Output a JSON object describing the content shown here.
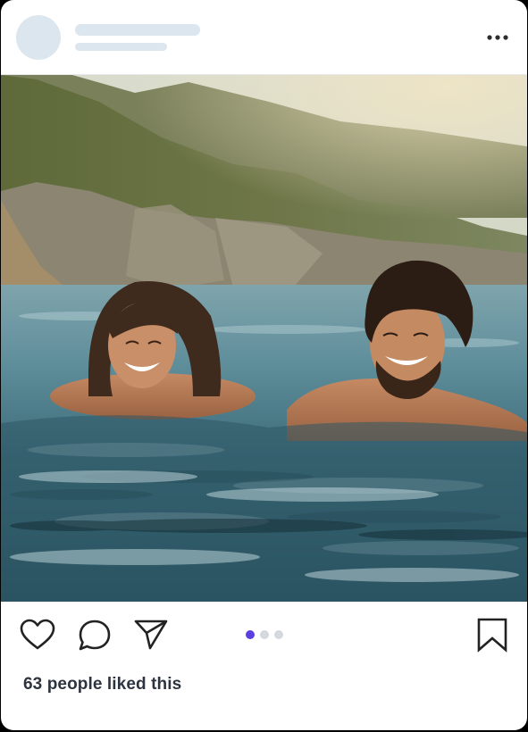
{
  "post": {
    "likes_text": "63 people liked this",
    "carousel": {
      "count": 3,
      "active_index": 0
    }
  },
  "header": {
    "avatar": "avatar-placeholder",
    "more_icon": "more-horizontal-icon"
  },
  "photo": {
    "alt": "Two people smiling while swimming in the sea"
  },
  "actions": {
    "icons": [
      "heart-icon",
      "comment-icon",
      "send-icon",
      "bookmark-icon"
    ]
  },
  "colors": {
    "accent": "#5b3fe0",
    "dot_inactive": "#d5d8dd",
    "skeleton": "#dbe6ee",
    "text": "#2d3440"
  }
}
